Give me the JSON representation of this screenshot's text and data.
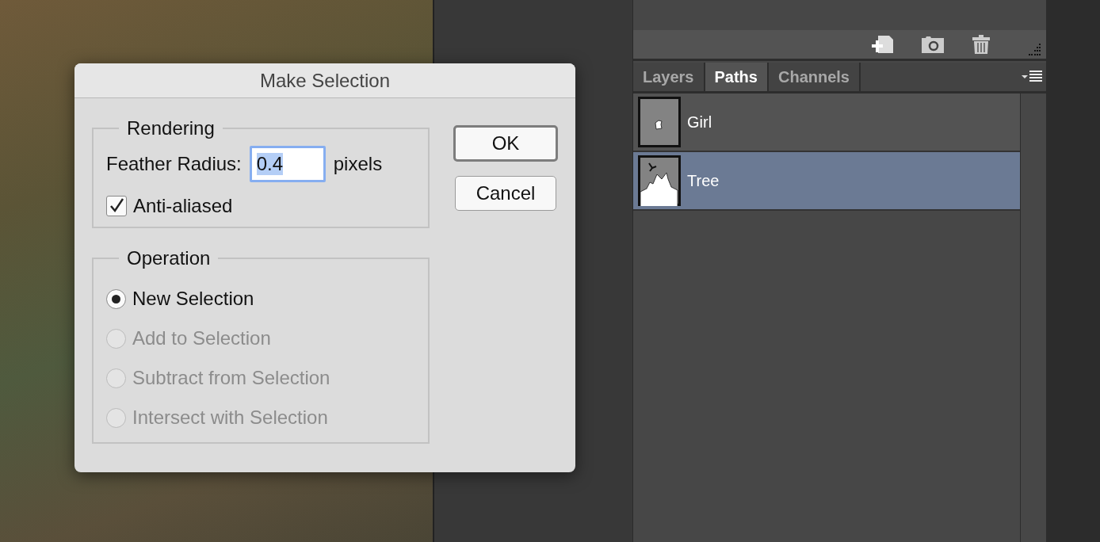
{
  "dialog": {
    "title": "Make Selection",
    "rendering": {
      "legend": "Rendering",
      "feather_label": "Feather Radius:",
      "feather_value": "0.4",
      "value_selected": true,
      "feather_unit": "pixels",
      "anti_aliased": {
        "label": "Anti-aliased",
        "checked": true
      }
    },
    "operation": {
      "legend": "Operation",
      "options": [
        {
          "label": "New Selection",
          "selected": true,
          "disabled": false
        },
        {
          "label": "Add to Selection",
          "selected": false,
          "disabled": true
        },
        {
          "label": "Subtract from Selection",
          "selected": false,
          "disabled": true
        },
        {
          "label": "Intersect with Selection",
          "selected": false,
          "disabled": true
        }
      ]
    },
    "buttons": [
      {
        "label": "OK",
        "default": true
      },
      {
        "label": "Cancel",
        "default": false
      }
    ]
  },
  "panel": {
    "tabs": [
      {
        "label": "Layers",
        "selected": false
      },
      {
        "label": "Paths",
        "selected": true
      },
      {
        "label": "Channels",
        "selected": false
      }
    ],
    "paths": [
      {
        "name": "Girl",
        "selected": false,
        "kind": "blob"
      },
      {
        "name": "Tree",
        "selected": true,
        "kind": "tree"
      }
    ]
  }
}
